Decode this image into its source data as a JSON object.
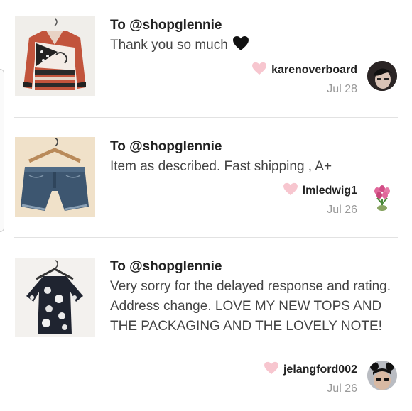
{
  "reviews": [
    {
      "to": "To @shopglennie",
      "comment": "Thank you so much",
      "comment_emoji": "black-heart-icon",
      "username": "karenoverboard",
      "date": "Jul 28",
      "item_image": "sweater-photo"
    },
    {
      "to": "To @shopglennie",
      "comment": "Item as described. Fast shipping , A+",
      "username": "lmledwig1",
      "date": "Jul 26",
      "item_image": "denim-shorts-photo"
    },
    {
      "to": "To @shopglennie",
      "comment": "Very sorry for the delayed response and rating. Address change. LOVE MY NEW TOPS AND THE PACKAGING AND THE LOVELY NOTE!",
      "username": "jelangford002",
      "date": "Jul 26",
      "item_image": "floral-top-photo"
    }
  ],
  "colors": {
    "heart": "#f7c6cf",
    "divider": "#e2e2e2",
    "date": "#999999"
  }
}
